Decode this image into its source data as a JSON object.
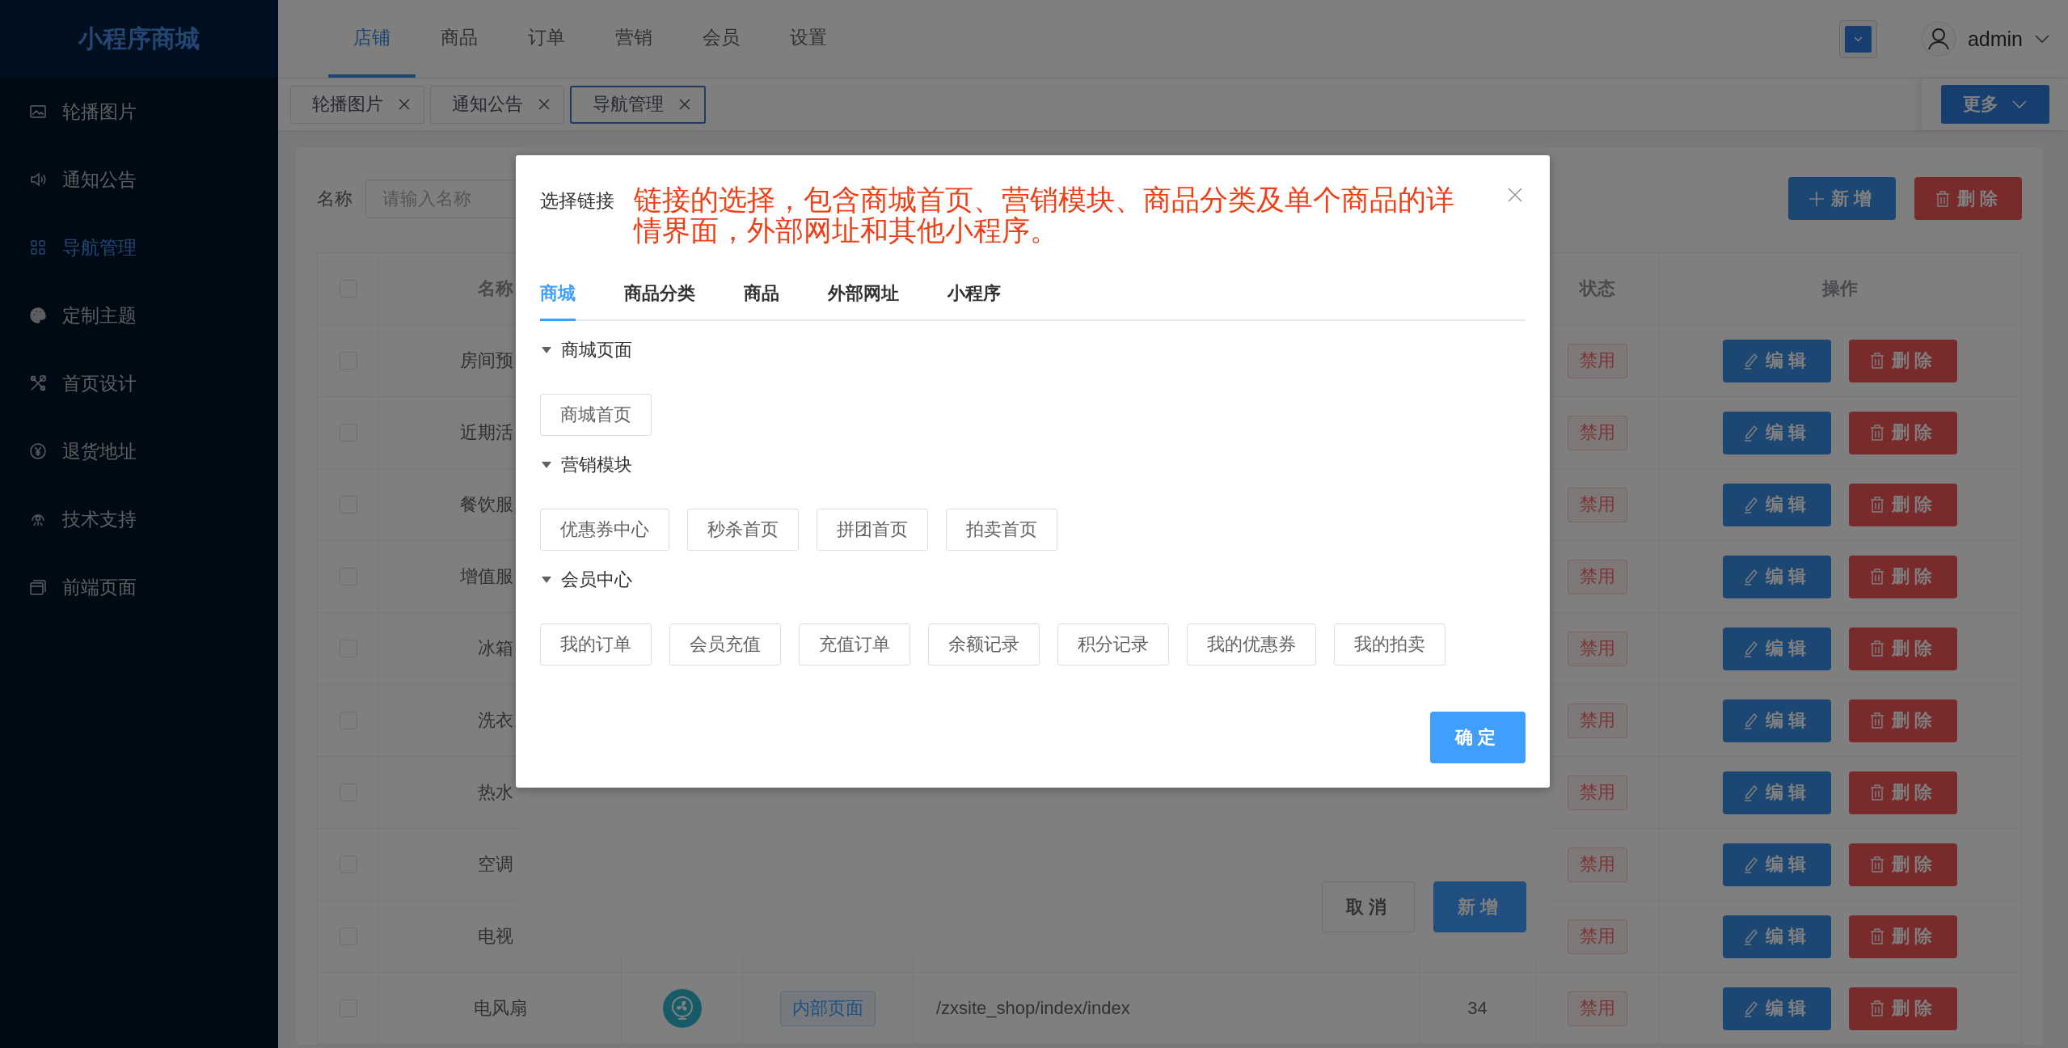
{
  "sidebar": {
    "logo": "小程序商城",
    "items": [
      {
        "label": "轮播图片",
        "selected": false
      },
      {
        "label": "通知公告",
        "selected": false
      },
      {
        "label": "导航管理",
        "selected": true
      },
      {
        "label": "定制主题",
        "selected": false
      },
      {
        "label": "首页设计",
        "selected": false
      },
      {
        "label": "退货地址",
        "selected": false
      },
      {
        "label": "技术支持",
        "selected": false
      },
      {
        "label": "前端页面",
        "selected": false
      }
    ]
  },
  "top_nav": [
    {
      "label": "店铺",
      "selected": true
    },
    {
      "label": "商品",
      "selected": false
    },
    {
      "label": "订单",
      "selected": false
    },
    {
      "label": "营销",
      "selected": false
    },
    {
      "label": "会员",
      "selected": false
    },
    {
      "label": "设置",
      "selected": false
    }
  ],
  "header": {
    "user": "admin"
  },
  "tags": [
    {
      "label": "轮播图片",
      "selected": false
    },
    {
      "label": "通知公告",
      "selected": false
    },
    {
      "label": "导航管理",
      "selected": true
    }
  ],
  "more_button": "更多",
  "search": {
    "label": "名称",
    "placeholder": "请输入名称"
  },
  "actions": [
    {
      "label": "新增",
      "kind": "primary"
    },
    {
      "label": "删除",
      "kind": "danger"
    }
  ],
  "table": {
    "header_checked": false,
    "columns": {
      "name": "名称",
      "status": "状态",
      "actions": "操作"
    },
    "rows": [
      {
        "checked": false,
        "name": "房间预",
        "status": "禁用",
        "buttons": [
          "编辑",
          "删除"
        ]
      },
      {
        "checked": false,
        "name": "近期活",
        "status": "禁用",
        "buttons": [
          "编辑",
          "删除"
        ]
      },
      {
        "checked": false,
        "name": "餐饮服",
        "status": "禁用",
        "buttons": [
          "编辑",
          "删除"
        ]
      },
      {
        "checked": false,
        "name": "增值服",
        "status": "禁用",
        "buttons": [
          "编辑",
          "删除"
        ]
      },
      {
        "checked": false,
        "name": "冰箱",
        "status": "禁用",
        "buttons": [
          "编辑",
          "删除"
        ]
      },
      {
        "checked": false,
        "name": "洗衣",
        "status": "禁用",
        "buttons": [
          "编辑",
          "删除"
        ]
      },
      {
        "checked": false,
        "name": "热水",
        "status": "禁用",
        "buttons": [
          "编辑",
          "删除"
        ]
      },
      {
        "checked": false,
        "name": "空调",
        "status": "禁用",
        "buttons": [
          "编辑",
          "删除"
        ]
      },
      {
        "checked": false,
        "name": "电视",
        "status": "禁用",
        "buttons": [
          "编辑",
          "删除"
        ]
      },
      {
        "checked": false,
        "name": "电风扇",
        "type": "内部页面",
        "path": "/zxsite_shop/index/index",
        "sort": "34",
        "status": "禁用",
        "buttons": [
          "编辑",
          "删除"
        ]
      }
    ]
  },
  "dialog_behind": {
    "buttons": [
      {
        "label": "取消",
        "kind": "default"
      },
      {
        "label": "新增",
        "kind": "primary"
      }
    ]
  },
  "dialog": {
    "title": "选择链接",
    "note": "链接的选择，包含商城首页、营销模块、商品分类及单个商品的详情界面，外部网址和其他小程序。",
    "tabs": [
      {
        "label": "商城",
        "selected": true
      },
      {
        "label": "商品分类",
        "selected": false
      },
      {
        "label": "商品",
        "selected": false
      },
      {
        "label": "外部网址",
        "selected": false
      },
      {
        "label": "小程序",
        "selected": false
      }
    ],
    "groups": [
      {
        "title": "商城页面",
        "expanded": true,
        "links": [
          "商城首页"
        ]
      },
      {
        "title": "营销模块",
        "expanded": true,
        "links": [
          "优惠券中心",
          "秒杀首页",
          "拼团首页",
          "拍卖首页"
        ]
      },
      {
        "title": "会员中心",
        "expanded": true,
        "links": [
          "我的订单",
          "会员充值",
          "充值订单",
          "余额记录",
          "积分记录",
          "我的优惠券",
          "我的拍卖"
        ]
      }
    ],
    "confirm": "确定"
  }
}
